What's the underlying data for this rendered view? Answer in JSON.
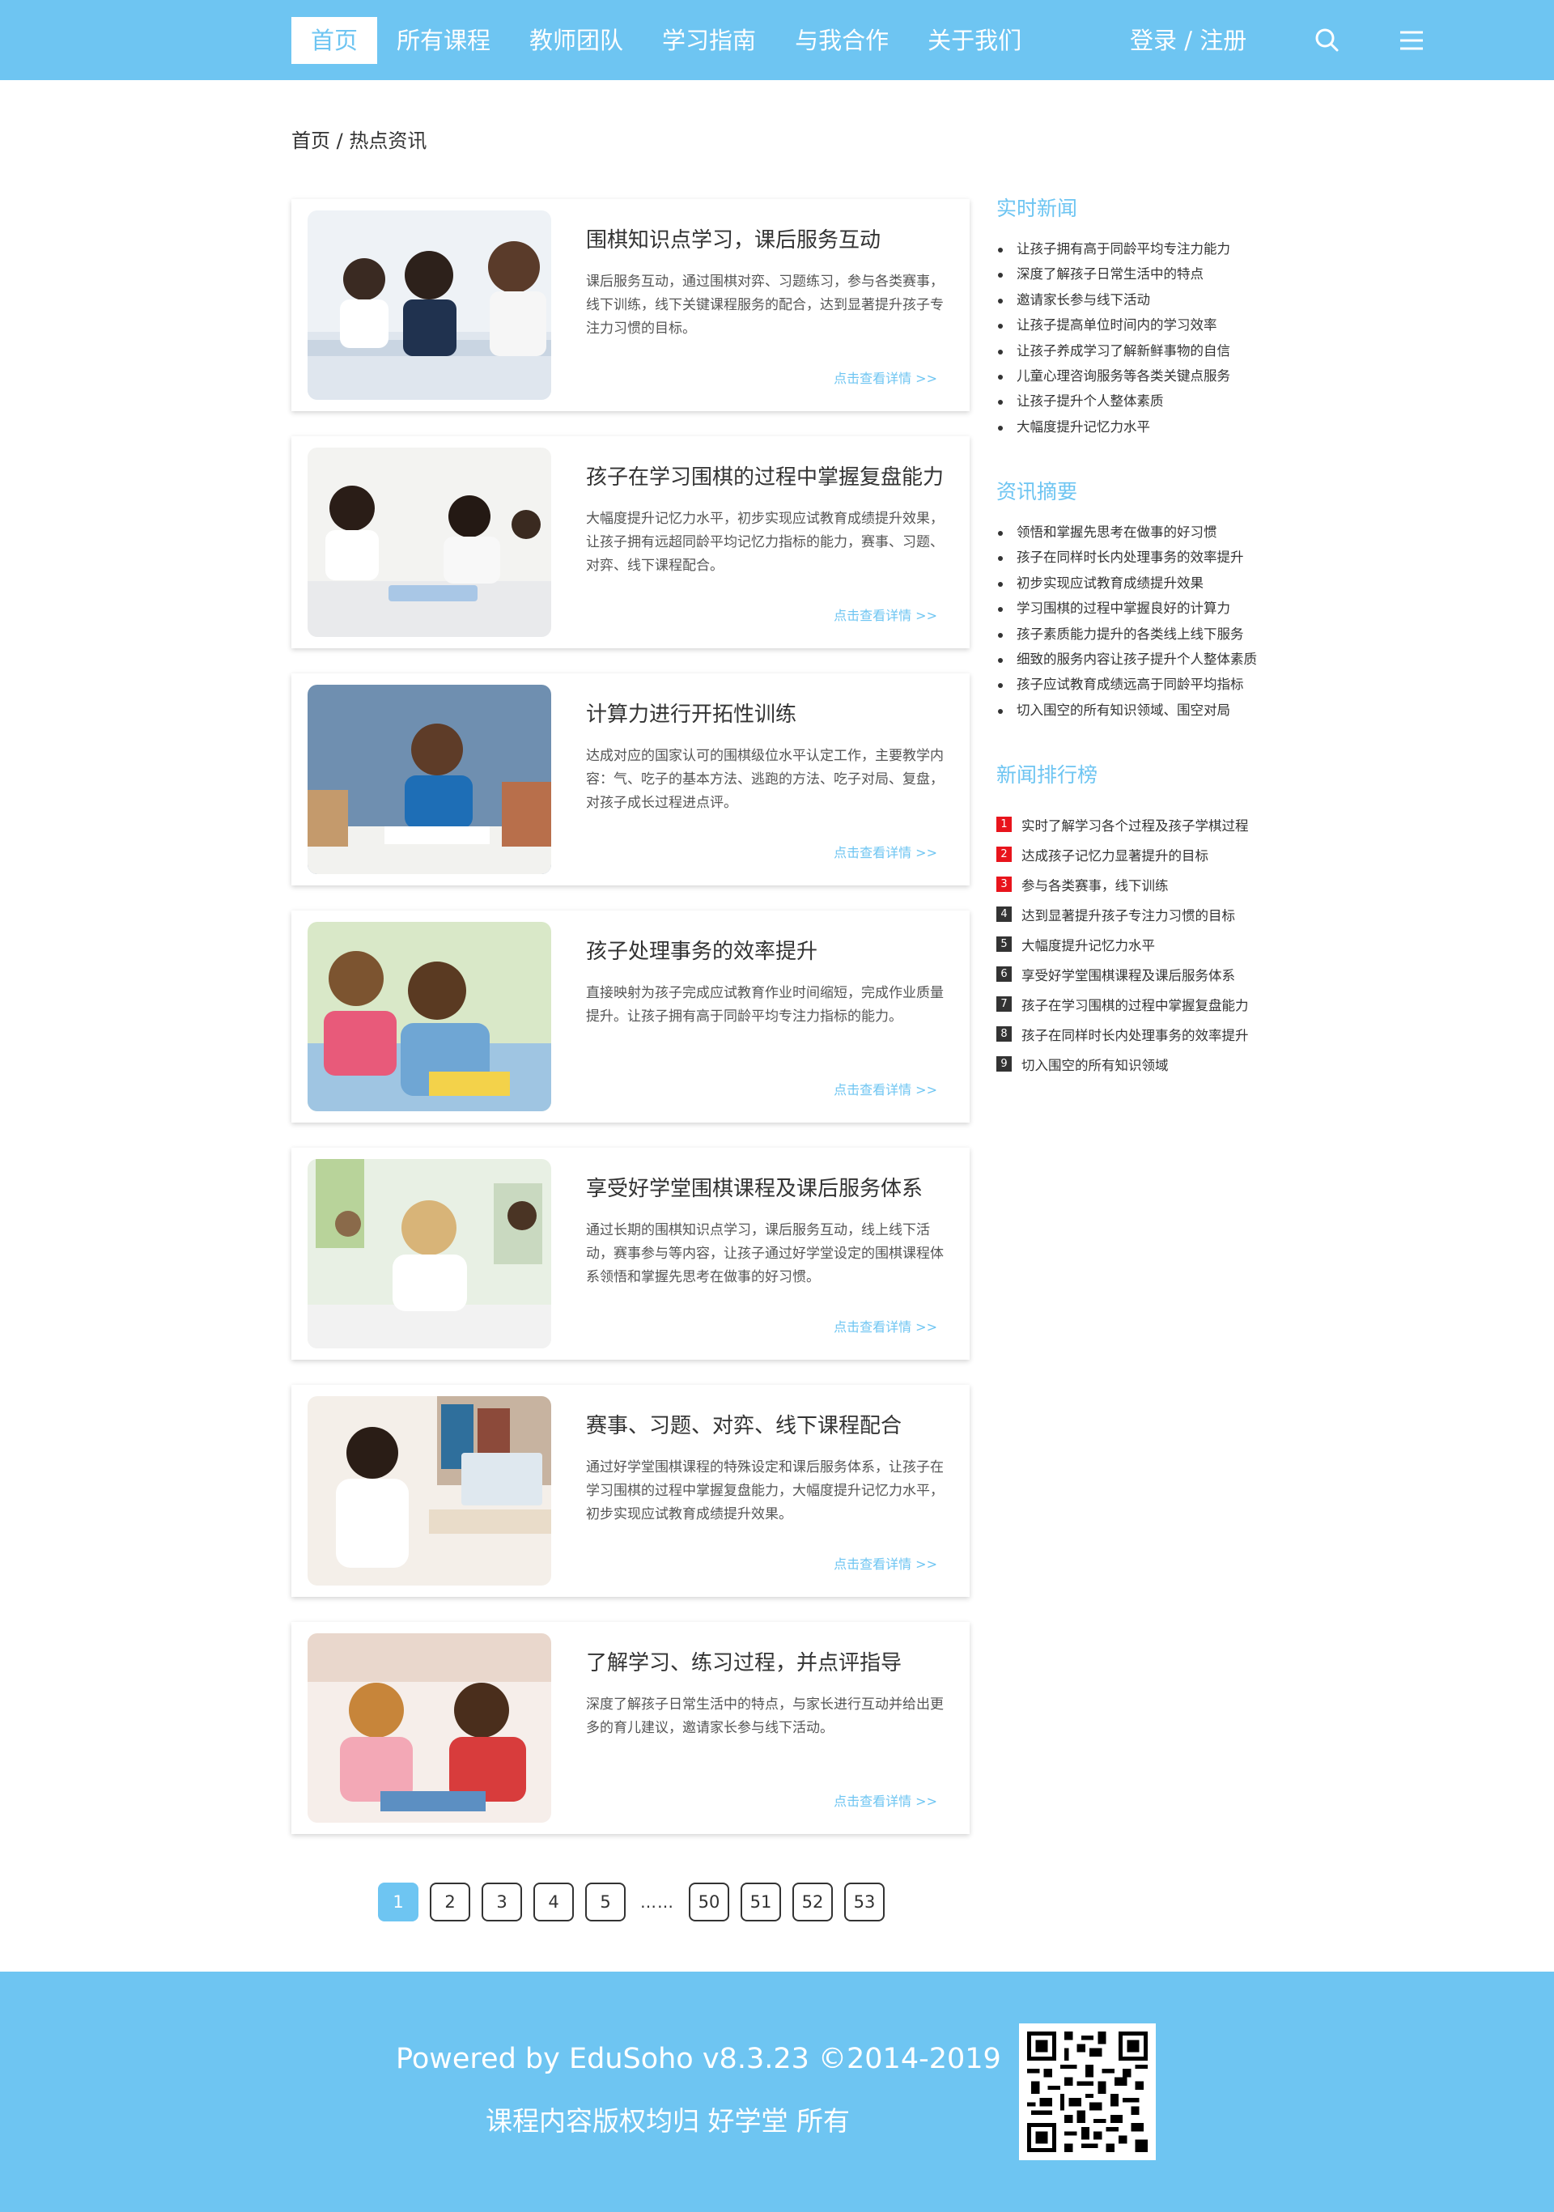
{
  "colors": {
    "brand": "#6ec5f2",
    "rank_top": "#e8141c",
    "rank_other": "#333333"
  },
  "nav": {
    "items": [
      {
        "label": "首页",
        "active": true
      },
      {
        "label": "所有课程"
      },
      {
        "label": "教师团队"
      },
      {
        "label": "学习指南"
      },
      {
        "label": "与我合作"
      },
      {
        "label": "关于我们"
      }
    ],
    "login": "登录 / 注册",
    "search_icon": "search-icon",
    "menu_icon": "menu-icon"
  },
  "breadcrumb": "首页 / 热点资讯",
  "articles": [
    {
      "title": "围棋知识点学习，课后服务互动",
      "desc": "课后服务互动，通过围棋对弈、习题练习，参与各类赛事，线下训练，线下关键课程服务的配合，达到显著提升孩子专注力习惯的目标。",
      "more": "点击查看详情 >>"
    },
    {
      "title": "孩子在学习围棋的过程中掌握复盘能力",
      "desc": "大幅度提升记忆力水平，初步实现应试教育成绩提升效果，让孩子拥有远超同龄平均记忆力指标的能力，赛事、习题、对弈、线下课程配合。",
      "more": "点击查看详情 >>"
    },
    {
      "title": "计算力进行开拓性训练",
      "desc": "达成对应的国家认可的围棋级位水平认定工作，主要教学内容：气、吃子的基本方法、逃跑的方法、吃子对局、复盘，对孩子成长过程进点评。",
      "more": "点击查看详情 >>"
    },
    {
      "title": "孩子处理事务的效率提升",
      "desc": "直接映射为孩子完成应试教育作业时间缩短，完成作业质量提升。让孩子拥有高于同龄平均专注力指标的能力。",
      "more": "点击查看详情 >>"
    },
    {
      "title": "享受好学堂围棋课程及课后服务体系",
      "desc": "通过长期的围棋知识点学习，课后服务互动，线上线下活动，赛事参与等内容，让孩子通过好学堂设定的围棋课程体系领悟和掌握先思考在做事的好习惯。",
      "more": "点击查看详情 >>"
    },
    {
      "title": "赛事、习题、对弈、线下课程配合",
      "desc": "通过好学堂围棋课程的特殊设定和课后服务体系，让孩子在学习围棋的过程中掌握复盘能力，大幅度提升记忆力水平，初步实现应试教育成绩提升效果。",
      "more": "点击查看详情 >>"
    },
    {
      "title": "了解学习、练习过程，并点评指导",
      "desc": "深度了解孩子日常生活中的特点，与家长进行互动并给出更多的育儿建议，邀请家长参与线下活动。",
      "more": "点击查看详情 >>"
    }
  ],
  "sidebar": {
    "realtime": {
      "heading": "实时新闻",
      "items": [
        "让孩子拥有高于同龄平均专注力能力",
        "深度了解孩子日常生活中的特点",
        "邀请家长参与线下活动",
        "让孩子提高单位时间内的学习效率",
        "让孩子养成学习了解新鲜事物的自信",
        "儿童心理咨询服务等各类关键点服务",
        "让孩子提升个人整体素质",
        "大幅度提升记忆力水平"
      ]
    },
    "summary": {
      "heading": "资讯摘要",
      "items": [
        "领悟和掌握先思考在做事的好习惯",
        "孩子在同样时长内处理事务的效率提升",
        "初步实现应试教育成绩提升效果",
        "学习围棋的过程中掌握良好的计算力",
        "孩子素质能力提升的各类线上线下服务",
        "细致的服务内容让孩子提升个人整体素质",
        "孩子应试教育成绩远高于同龄平均指标",
        "切入围空的所有知识领域、围空对局"
      ]
    },
    "ranking": {
      "heading": "新闻排行榜",
      "items": [
        {
          "num": "1",
          "text": "实时了解学习各个过程及孩子学棋过程"
        },
        {
          "num": "2",
          "text": "达成孩子记忆力显著提升的目标"
        },
        {
          "num": "3",
          "text": "参与各类赛事，线下训练"
        },
        {
          "num": "4",
          "text": "达到显著提升孩子专注力习惯的目标"
        },
        {
          "num": "5",
          "text": "大幅度提升记忆力水平"
        },
        {
          "num": "6",
          "text": "享受好学堂围棋课程及课后服务体系"
        },
        {
          "num": "7",
          "text": "孩子在学习围棋的过程中掌握复盘能力"
        },
        {
          "num": "8",
          "text": "孩子在同样时长内处理事务的效率提升"
        },
        {
          "num": "9",
          "text": "切入围空的所有知识领域"
        }
      ]
    }
  },
  "pagination": {
    "current": "1",
    "pages_before": [
      "1",
      "2",
      "3",
      "4",
      "5"
    ],
    "ellipsis": "……",
    "pages_after": [
      "50",
      "51",
      "52",
      "53"
    ]
  },
  "footer": {
    "line1": "Powered by EduSoho v8.3.23 ©2014-2019",
    "line2": "课程内容版权均归 好学堂 所有",
    "qr_icon": "qr-code-icon"
  }
}
